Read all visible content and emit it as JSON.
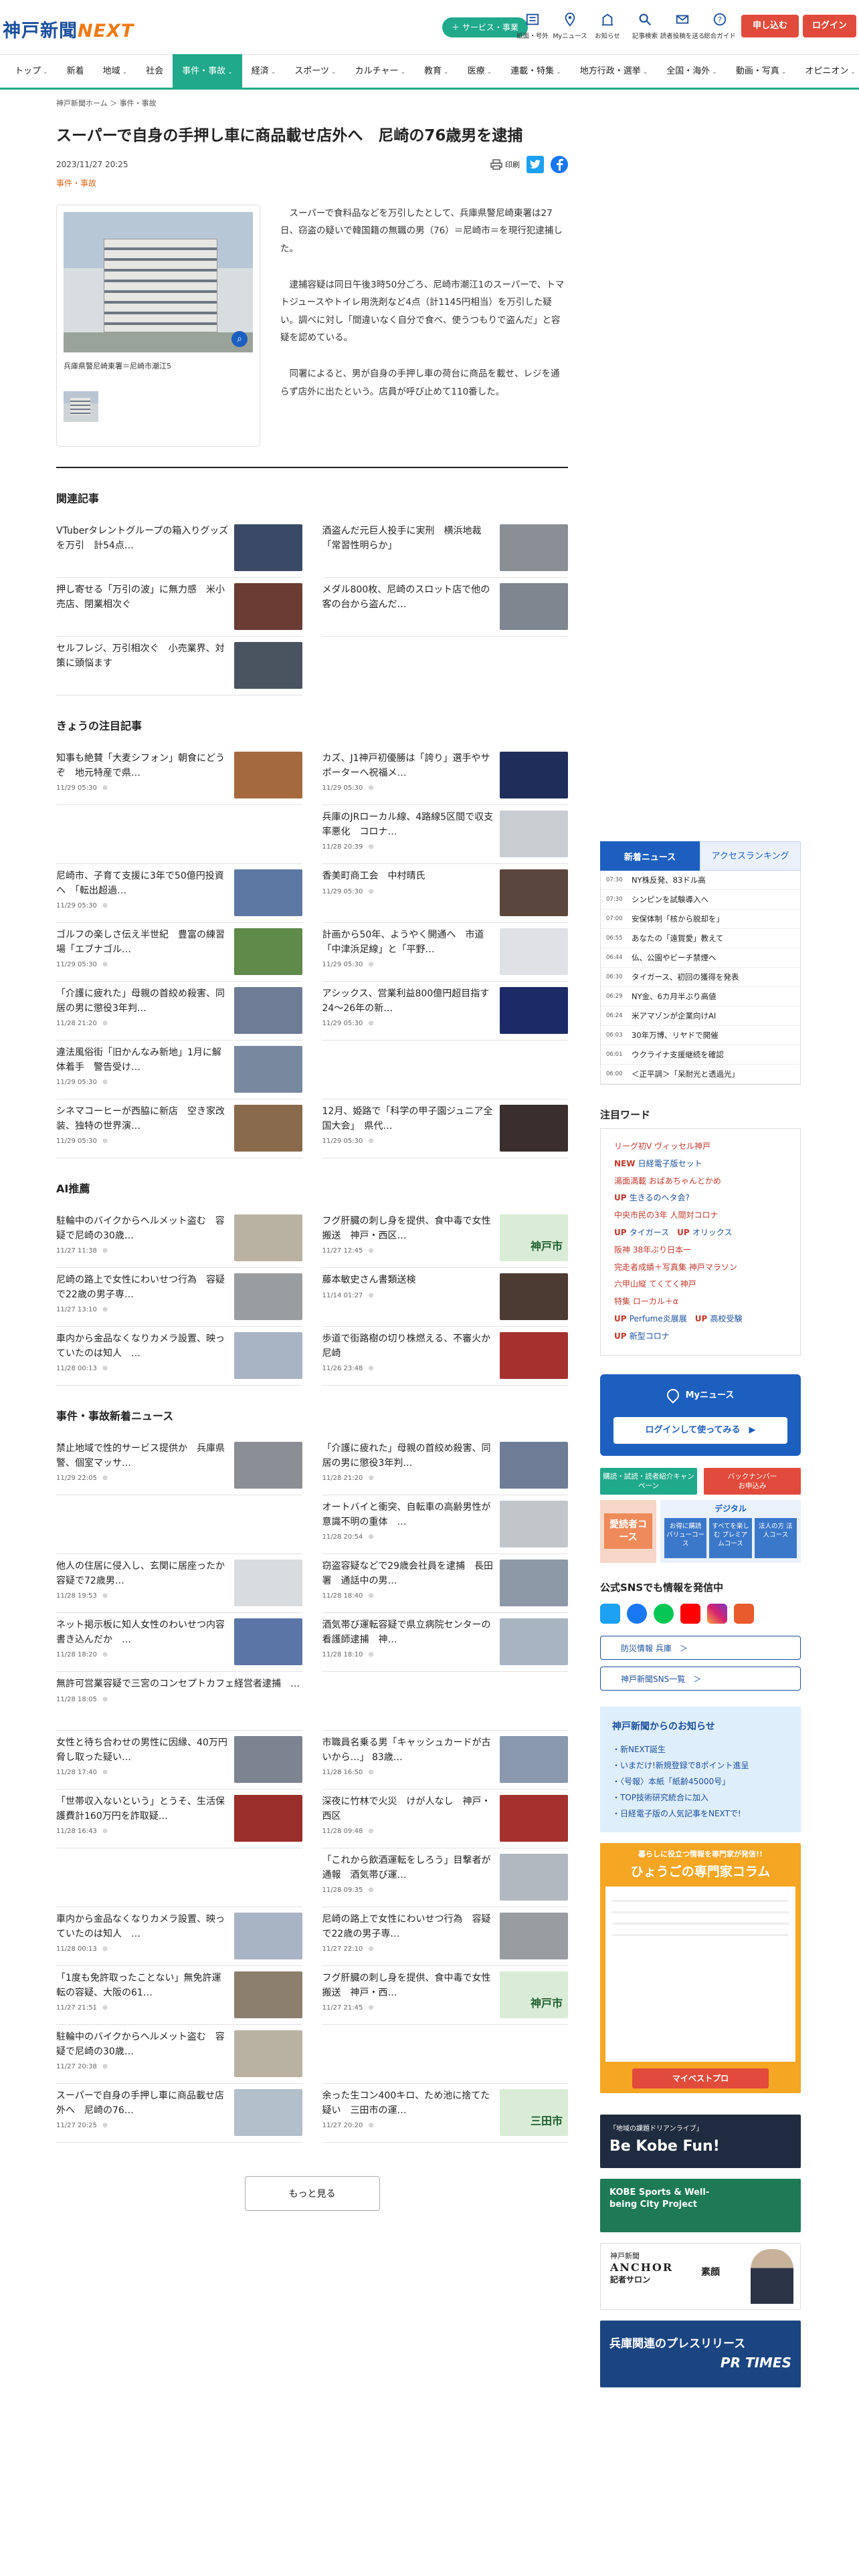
{
  "header": {
    "logo_main": "神戸新聞",
    "logo_next": "NEXT",
    "service_label": "サービス・事業",
    "icons": [
      "紙面・号外",
      "Myニュース",
      "お知らせ"
    ],
    "icons2": [
      "記事検索",
      "読者投稿を送る",
      "総合ガイド"
    ],
    "signup": "申し込む",
    "login": "ログイン"
  },
  "nav": [
    {
      "label": "トップ",
      "chev": true
    },
    {
      "label": "新着",
      "chev": false
    },
    {
      "label": "地域",
      "chev": true
    },
    {
      "label": "社会",
      "chev": false
    },
    {
      "label": "事件・事故",
      "chev": true,
      "active": true
    },
    {
      "label": "経済",
      "chev": true
    },
    {
      "label": "スポーツ",
      "chev": true
    },
    {
      "label": "カルチャー",
      "chev": true
    },
    {
      "label": "教育",
      "chev": true
    },
    {
      "label": "医療",
      "chev": true
    },
    {
      "label": "連載・特集",
      "chev": true
    },
    {
      "label": "地方行政・選挙",
      "chev": true
    },
    {
      "label": "全国・海外",
      "chev": true
    },
    {
      "label": "動画・写真",
      "chev": true
    },
    {
      "label": "オピニオン",
      "chev": true
    }
  ],
  "article": {
    "breadcrumb": "神戸新聞ホーム ＞ 事件・事故",
    "title": "スーパーで自身の手押し車に商品載せ店外へ　尼崎の76歳男を逮捕",
    "date": "2023/11/27 20:25",
    "print": "印刷",
    "category": "事件・事故",
    "caption": "兵庫県警尼崎東署＝尼崎市潮江5",
    "paragraphs": [
      "スーパーで食料品などを万引したとして、兵庫県警尼崎東署は27日、窃盗の疑いで韓国籍の無職の男（76）＝尼崎市＝を現行犯逮捕した。",
      "逮捕容疑は同日午後3時50分ごろ、尼崎市潮江1のスーパーで、トマトジュースやトイレ用洗剤など4点（計1145円相当）を万引した疑い。調べに対し「間違いなく自分で食べ、使うつもりで盗んだ」と容疑を認めている。",
      "同署によると、男が自身の手押し車の荷台に商品を載せ、レジを通らず店外に出たという。店員が呼び止めて110番した。"
    ]
  },
  "related": {
    "title": "関連記事",
    "items": [
      {
        "t": "VTuberタレントグループの箱入りグッズを万引　計54点…",
        "d": "",
        "c": "#3a4a66"
      },
      {
        "t": "酒盗んだ元巨人投手に実刑　横浜地裁「常習性明らか」",
        "d": "",
        "c": "#8a8f96"
      },
      {
        "t": "押し寄せる「万引の波」に無力感　米小売店、閉業相次ぐ",
        "d": "",
        "c": "#6b3c34"
      },
      {
        "t": "メダル800枚、尼崎のスロット店で他の客の台から盗んだ…",
        "d": "",
        "c": "#7f8690"
      },
      {
        "t": "セルフレジ、万引相次ぐ　小売業界、対策に頭悩ます",
        "d": "",
        "c": "#4a5360"
      }
    ]
  },
  "today": {
    "title": "きょうの注目記事",
    "items": [
      {
        "t": "知事も絶賛「大麦シフォン」朝食にどうぞ　地元特産で県…",
        "d": "11/29 05:30",
        "c": "#a46a3e"
      },
      {
        "t": "カズ、J1神戸初優勝は「誇り」選手やサポーターへ祝福メ…",
        "d": "11/29 05:30",
        "c": "#1f2d5a"
      },
      {
        "t": "",
        "d": "",
        "c": ""
      },
      {
        "t": "兵庫のJRローカル線、4路線5区間で収支率悪化　コロナ…",
        "d": "11/28 20:39",
        "c": "#c9ccd1"
      },
      {
        "t": "尼崎市、子育て支援に3年で50億円投資へ　「転出超過…",
        "d": "11/29 05:30",
        "c": "#5d79a3"
      },
      {
        "t": "香美町商工会　中村晴氏",
        "d": "11/29 05:30",
        "c": "#5a463c"
      },
      {
        "t": "ゴルフの楽しさ伝え半世紀　豊富の練習場「エブナゴル…",
        "d": "11/29 05:30",
        "c": "#5f8a4a"
      },
      {
        "t": "計画から50年、ようやく開通へ　市道「中津浜足線」と「平野…",
        "d": "11/29 05:30",
        "c": "#dfe1e4"
      },
      {
        "t": "「介護に疲れた」母親の首絞め殺害、同居の男に懲役3年判…",
        "d": "11/28 21:20",
        "c": "#6e7d95"
      },
      {
        "t": "アシックス、営業利益800億円超目指す　24～26年の新…",
        "d": "11/29 05:30",
        "c": "#1c2b66"
      },
      {
        "t": "違法風俗街「旧かんなみ新地」1月に解体着手　警告受け…",
        "d": "11/29 05:30",
        "c": "#78889f"
      },
      {
        "t": "",
        "d": "",
        "c": ""
      },
      {
        "t": "シネマコーヒーが西脇に新店　空き家改装、独特の世界演…",
        "d": "11/29 05:30",
        "c": "#8a6a4c"
      },
      {
        "t": "12月、姫路で「科学の甲子園ジュニア全国大会」　県代…",
        "d": "11/29 05:30",
        "c": "#3a2f2d"
      }
    ]
  },
  "ai": {
    "title": "AI推薦",
    "items": [
      {
        "t": "駐輪中のバイクからヘルメット盗む　容疑で尼崎の30歳…",
        "d": "11/27 11:38",
        "c": "#b9b2a3"
      },
      {
        "t": "フグ肝臓の刺し身を提供、食中毒で女性搬送　神戸・西区…",
        "d": "11/27 12:45",
        "c": "#d8ecd6",
        "k": "神戸市"
      },
      {
        "t": "尼崎の路上で女性にわいせつ行為　容疑で22歳の男子専…",
        "d": "11/27 13:10",
        "c": "#9a9d9f"
      },
      {
        "t": "藤本敏史さん書類送検",
        "d": "11/14 01:27",
        "c": "#4c3b33"
      },
      {
        "t": "車内から金品なくなりカメラ設置、映っていたのは知人　…",
        "d": "11/28 00:13",
        "c": "#a8b4c4"
      },
      {
        "t": "歩道で街路樹の切り株燃える、不審火か　尼崎",
        "d": "11/26 23:48",
        "c": "#a3322e"
      }
    ]
  },
  "latest": {
    "title": "事件・事故新着ニュース",
    "items": [
      {
        "t": "禁止地域で性的サービス提供か　兵庫県警、個室マッサ…",
        "d": "11/29 22:05",
        "c": "#8b8e95"
      },
      {
        "t": "「介護に疲れた」母親の首絞め殺害、同居の男に懲役3年判…",
        "d": "11/28 21:20",
        "c": "#6e7d95"
      },
      {
        "t": "",
        "d": "",
        "c": ""
      },
      {
        "t": "オートバイと衝突、自転車の高齢男性が意識不明の重体　…",
        "d": "11/28 20:54",
        "c": "#c2c6cb"
      },
      {
        "t": "他人の住居に侵入し、玄関に居座ったか　容疑で72歳男…",
        "d": "11/28 19:53",
        "c": "#d9dcdf"
      },
      {
        "t": "窃盗容疑などで29歳会社員を逮捕　長田署　通話中の男…",
        "d": "11/28 18:40",
        "c": "#8e99a8"
      },
      {
        "t": "ネット掲示板に知人女性のわいせつ内容書き込んだか　…",
        "d": "11/28 18:20",
        "c": "#5a76a6"
      },
      {
        "t": "酒気帯び運転容疑で県立病院センターの看護師逮捕　神…",
        "d": "11/28 18:10",
        "c": "#a9b4c2"
      },
      {
        "t": "無許可営業容疑で三宮のコンセプトカフェ経営者逮捕　…",
        "d": "11/28 18:05",
        "c": ""
      },
      {
        "t": "",
        "d": "",
        "c": ""
      },
      {
        "t": "女性と待ち合わせの男性に因縁、40万円脅し取った疑い…",
        "d": "11/28 17:40",
        "c": "#7d8490"
      },
      {
        "t": "市職員名乗る男「キャッシュカードが古いから…」 83歳…",
        "d": "11/28 16:50",
        "c": "#8a98ad"
      },
      {
        "t": "「世帯収入ないという」とうそ、生活保護費計160万円を詐取疑…",
        "d": "11/28 16:43",
        "c": "#9a2e2a"
      },
      {
        "t": "深夜に竹林で火災　けが人なし　神戸・西区",
        "d": "11/28 09:48",
        "c": "#a3322e"
      },
      {
        "t": "",
        "d": "",
        "c": ""
      },
      {
        "t": "「これから飲酒運転をしろう」目撃者が通報　酒気帯び運…",
        "d": "11/28 09:35",
        "c": "#b1b8c0"
      },
      {
        "t": "車内から金品なくなりカメラ設置、映っていたのは知人　…",
        "d": "11/28 00:13",
        "c": "#a8b4c4"
      },
      {
        "t": "尼崎の路上で女性にわいせつ行為　容疑で22歳の男子専…",
        "d": "11/27 22:10",
        "c": "#9a9d9f"
      },
      {
        "t": "「1度も免許取ったことない」無免許運転の容疑、大阪の61…",
        "d": "11/27 21:51",
        "c": "#8d7f6e"
      },
      {
        "t": "フグ肝臓の刺し身を提供、食中毒で女性搬送　神戸・西…",
        "d": "11/27 21:45",
        "c": "#d8ecd6",
        "k": "神戸市"
      },
      {
        "t": "駐輪中のバイクからヘルメット盗む　容疑で尼崎の30歳…",
        "d": "11/27 20:38",
        "c": "#b9b2a3"
      },
      {
        "t": "",
        "d": "",
        "c": ""
      },
      {
        "t": "スーパーで自身の手押し車に商品載せ店外へ　尼崎の76…",
        "d": "11/27 20:25",
        "c": "#b3bfcb"
      },
      {
        "t": "余った生コン400キロ、ため池に捨てた疑い　三田市の運…",
        "d": "11/27 20:20",
        "c": "#d8ecd6",
        "k": "三田市"
      }
    ],
    "more": "もっと見る"
  },
  "sidebar": {
    "tab_new": "新着ニュース",
    "tab_rank": "アクセスランキング",
    "ranking": [
      {
        "tm": "07:30",
        "t": "NY株反発、83ドル高"
      },
      {
        "tm": "07:30",
        "t": "シンピンを試験導入へ"
      },
      {
        "tm": "07:00",
        "t": "安保体制「核から脱却を」"
      },
      {
        "tm": "06:55",
        "t": "あなたの「遠賀愛」教えて"
      },
      {
        "tm": "06:44",
        "t": "仏、公園やビーチ禁煙へ"
      },
      {
        "tm": "06:30",
        "t": "タイガース、初回の獲得を発表"
      },
      {
        "tm": "06:29",
        "t": "NY金、6カ月半ぶり高値"
      },
      {
        "tm": "06:24",
        "t": "米アマゾンが企業向けAI"
      },
      {
        "tm": "06:03",
        "t": "30年万博、リヤドで開催"
      },
      {
        "tm": "06:01",
        "t": "ウクライナ支援継続を確認"
      },
      {
        "tm": "06:00",
        "t": "＜正平調＞「呆耐光と透過光」"
      }
    ],
    "words_title": "注目ワード",
    "words": [
      {
        "t": "リーグ初V ヴィッセル神戸",
        "up": ""
      },
      {
        "t": "日経電子版セット",
        "up": "NEW "
      },
      {
        "t": "湯面満載 おばあちゃんとかめ",
        "up": ""
      },
      {
        "t": "生きるのへタ会?",
        "up": "UP "
      },
      {
        "t": "中央市民の3年 人間対コロナ",
        "up": ""
      },
      {
        "t": "タイガース",
        "up": "UP "
      },
      {
        "t": "オリックス",
        "up": "UP "
      },
      {
        "t": "阪神 38年ぶり日本一",
        "up": ""
      },
      {
        "t": "完走者成績＋写真集 神戸マラソン",
        "up": ""
      },
      {
        "t": "六甲山縦 てくてく神戸",
        "up": ""
      },
      {
        "t": "特集 ローカル＋α",
        "up": ""
      },
      {
        "t": "Perfume炎展展",
        "up": "UP "
      },
      {
        "t": "高校受験",
        "up": "UP "
      },
      {
        "t": "新型コロナ",
        "up": "UP "
      }
    ],
    "my_label": "Myニュース",
    "my_login": "ログインして使ってみる　▶",
    "green1": "購読・試読・読者紹介キャンペーン",
    "red1": "バックナンバー\nお申込み",
    "course_title": "デジタル",
    "course_left": "愛読者コース",
    "courses": [
      "お得に購読 バリューコース",
      "すべてを楽しむ プレミアムコース",
      "法人の方 法人コース"
    ],
    "sns_title": "公式SNSでも情報を発信中",
    "link1": "防災情報 兵庫　＞",
    "link2": "神戸新聞SNS一覧　＞",
    "notice_title": "神戸新聞からのお知らせ",
    "notices": [
      "・新NEXT誕生",
      "・いまだけ!新規登録で8ポイント進呈",
      "・〈号報〉本紙「紙齢45000号」",
      "・TOP技術研究統合に加入",
      "・日経電子版の人気記事をNEXTで!"
    ],
    "column_top": "暮らしに役立つ情報を専門家が発信!!",
    "column_title": "ひょうごの専門家コラム",
    "column_btn": "マイベストプロ",
    "b1": "Be Kobe Fun!",
    "b1s": "「地域の課題ドリアンライブ」",
    "b2": "KOBE Sports & Well-being City Project",
    "b3a": "神戸新聞",
    "b3b": "ANCHOR",
    "b3c": "記者サロン",
    "b3d": "素顔",
    "b4a": "兵庫関連のプレスリリース",
    "b4b": "PR TIMES"
  },
  "colors": {
    "accent": "#20a98b",
    "brand": "#1b4f9c",
    "blue": "#1d5fbf",
    "orange": "#e0681e"
  }
}
